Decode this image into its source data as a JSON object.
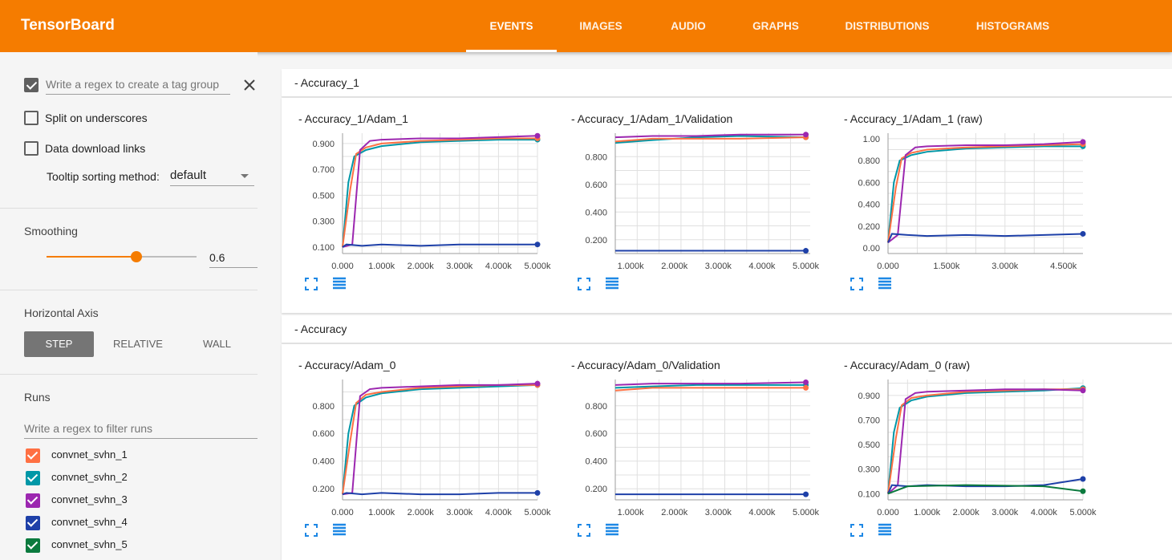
{
  "app": {
    "title": "TensorBoard"
  },
  "tabs": [
    {
      "label": "EVENTS",
      "active": true
    },
    {
      "label": "IMAGES",
      "active": false
    },
    {
      "label": "AUDIO",
      "active": false
    },
    {
      "label": "GRAPHS",
      "active": false
    },
    {
      "label": "DISTRIBUTIONS",
      "active": false
    },
    {
      "label": "HISTOGRAMS",
      "active": false
    }
  ],
  "sidebar": {
    "tag_group": {
      "checked": true,
      "placeholder": "Write a regex to create a tag group",
      "value": ""
    },
    "split_underscores": {
      "label": "Split on underscores",
      "checked": false
    },
    "data_download": {
      "label": "Data download links",
      "checked": false
    },
    "tooltip_sorting": {
      "label": "Tooltip sorting method:",
      "value": "default"
    },
    "smoothing": {
      "title": "Smoothing",
      "value": "0.6",
      "slider_fraction": 0.6
    },
    "horizontal_axis": {
      "title": "Horizontal Axis",
      "options": [
        "STEP",
        "RELATIVE",
        "WALL"
      ],
      "selected": "STEP"
    },
    "runs": {
      "title": "Runs",
      "filter_placeholder": "Write a regex to filter runs",
      "items": [
        {
          "name": "convnet_svhn_1",
          "color": "#ff7043",
          "checked": true
        },
        {
          "name": "convnet_svhn_2",
          "color": "#0097a7",
          "checked": true
        },
        {
          "name": "convnet_svhn_3",
          "color": "#9c27b0",
          "checked": true
        },
        {
          "name": "convnet_svhn_4",
          "color": "#1e40a8",
          "checked": true
        },
        {
          "name": "convnet_svhn_5",
          "color": "#0b7a3e",
          "checked": true
        }
      ]
    }
  },
  "colors": {
    "accent": "#f57c00",
    "run1": "#ff7043",
    "run2": "#0097a7",
    "run3": "#9c27b0",
    "run4": "#1e40a8",
    "run5": "#0b7a3e",
    "icon_blue": "#1e88e5"
  },
  "categories": [
    {
      "title": "- Accuracy_1"
    },
    {
      "title": "- Accuracy"
    }
  ],
  "chart_data": [
    {
      "type": "line",
      "title": "- Accuracy_1/Adam_1",
      "xlim": [
        0,
        5000
      ],
      "ylim": [
        0.05,
        0.98
      ],
      "x_ticks": [
        0,
        1000,
        2000,
        3000,
        4000,
        5000
      ],
      "x_tick_labels": [
        "0.000",
        "1.000k",
        "2.000k",
        "3.000k",
        "4.000k",
        "5.000k"
      ],
      "y_ticks": [
        0.1,
        0.3,
        0.5,
        0.7,
        0.9
      ],
      "y_tick_labels": [
        "0.100",
        "0.300",
        "0.500",
        "0.700",
        "0.900"
      ],
      "series": [
        {
          "color": "#0097a7",
          "x": [
            0,
            150,
            300,
            600,
            1000,
            2000,
            3000,
            4000,
            5000
          ],
          "y": [
            0.1,
            0.6,
            0.8,
            0.85,
            0.88,
            0.91,
            0.92,
            0.93,
            0.93
          ]
        },
        {
          "color": "#ff7043",
          "x": [
            0,
            200,
            350,
            600,
            1000,
            2000,
            3000,
            4000,
            5000
          ],
          "y": [
            0.1,
            0.55,
            0.82,
            0.87,
            0.9,
            0.92,
            0.93,
            0.94,
            0.94
          ]
        },
        {
          "color": "#9c27b0",
          "x": [
            0,
            250,
            450,
            700,
            1000,
            2000,
            3000,
            4000,
            5000
          ],
          "y": [
            0.1,
            0.12,
            0.85,
            0.92,
            0.93,
            0.94,
            0.94,
            0.95,
            0.96
          ]
        },
        {
          "color": "#1e40a8",
          "x": [
            0,
            100,
            500,
            1000,
            2000,
            3000,
            4000,
            5000
          ],
          "y": [
            0.1,
            0.12,
            0.11,
            0.12,
            0.11,
            0.12,
            0.12,
            0.12
          ]
        }
      ]
    },
    {
      "type": "line",
      "title": "- Accuracy_1/Adam_1/Validation",
      "xlim": [
        650,
        5100
      ],
      "ylim": [
        0.1,
        0.97
      ],
      "x_ticks": [
        1000,
        2000,
        3000,
        4000,
        5000
      ],
      "x_tick_labels": [
        "1.000k",
        "2.000k",
        "3.000k",
        "4.000k",
        "5.000k"
      ],
      "y_ticks": [
        0.2,
        0.4,
        0.6,
        0.8
      ],
      "y_tick_labels": [
        "0.200",
        "0.400",
        "0.600",
        "0.800"
      ],
      "series": [
        {
          "color": "#0097a7",
          "x": [
            650,
            1500,
            2500,
            3500,
            5000
          ],
          "y": [
            0.9,
            0.92,
            0.94,
            0.95,
            0.94
          ]
        },
        {
          "color": "#ff7043",
          "x": [
            650,
            1500,
            2500,
            3500,
            5000
          ],
          "y": [
            0.91,
            0.93,
            0.93,
            0.93,
            0.94
          ]
        },
        {
          "color": "#9c27b0",
          "x": [
            650,
            1500,
            2500,
            3500,
            5000
          ],
          "y": [
            0.94,
            0.95,
            0.95,
            0.96,
            0.96
          ]
        },
        {
          "color": "#1e40a8",
          "x": [
            650,
            2000,
            3500,
            5000
          ],
          "y": [
            0.12,
            0.12,
            0.12,
            0.12
          ]
        }
      ]
    },
    {
      "type": "line",
      "title": "- Accuracy_1/Adam_1 (raw)",
      "xlim": [
        0,
        5000
      ],
      "ylim": [
        -0.05,
        1.05
      ],
      "x_ticks": [
        0,
        1500,
        3000,
        4500
      ],
      "x_tick_labels": [
        "0.000",
        "1.500k",
        "3.000k",
        "4.500k"
      ],
      "y_ticks": [
        0,
        0.2,
        0.4,
        0.6,
        0.8,
        1.0
      ],
      "y_tick_labels": [
        "0.00",
        "0.200",
        "0.400",
        "0.600",
        "0.800",
        "1.00"
      ],
      "series": [
        {
          "color": "#0097a7",
          "x": [
            0,
            150,
            300,
            600,
            1000,
            2000,
            3000,
            4000,
            5000
          ],
          "y": [
            0.05,
            0.6,
            0.8,
            0.85,
            0.88,
            0.91,
            0.92,
            0.93,
            0.93
          ]
        },
        {
          "color": "#ff7043",
          "x": [
            0,
            200,
            350,
            600,
            1000,
            2000,
            3000,
            4000,
            5000
          ],
          "y": [
            0.05,
            0.55,
            0.82,
            0.87,
            0.9,
            0.92,
            0.93,
            0.94,
            0.95
          ]
        },
        {
          "color": "#9c27b0",
          "x": [
            0,
            250,
            450,
            700,
            1000,
            2000,
            3000,
            4000,
            5000
          ],
          "y": [
            0.05,
            0.12,
            0.85,
            0.92,
            0.93,
            0.94,
            0.94,
            0.95,
            0.97
          ]
        },
        {
          "color": "#1e40a8",
          "x": [
            0,
            100,
            500,
            1000,
            2000,
            3000,
            4000,
            5000
          ],
          "y": [
            0.05,
            0.13,
            0.12,
            0.11,
            0.12,
            0.11,
            0.12,
            0.13
          ]
        }
      ]
    },
    {
      "type": "line",
      "title": "- Accuracy/Adam_0",
      "xlim": [
        0,
        5000
      ],
      "ylim": [
        0.12,
        0.99
      ],
      "x_ticks": [
        0,
        1000,
        2000,
        3000,
        4000,
        5000
      ],
      "x_tick_labels": [
        "0.000",
        "1.000k",
        "2.000k",
        "3.000k",
        "4.000k",
        "5.000k"
      ],
      "y_ticks": [
        0.2,
        0.4,
        0.6,
        0.8
      ],
      "y_tick_labels": [
        "0.200",
        "0.400",
        "0.600",
        "0.800"
      ],
      "series": [
        {
          "color": "#0097a7",
          "x": [
            0,
            150,
            300,
            600,
            1000,
            2000,
            3000,
            4000,
            5000
          ],
          "y": [
            0.16,
            0.6,
            0.8,
            0.86,
            0.89,
            0.92,
            0.93,
            0.94,
            0.95
          ]
        },
        {
          "color": "#ff7043",
          "x": [
            0,
            200,
            350,
            600,
            1000,
            2000,
            3000,
            4000,
            5000
          ],
          "y": [
            0.16,
            0.55,
            0.82,
            0.88,
            0.9,
            0.93,
            0.94,
            0.95,
            0.95
          ]
        },
        {
          "color": "#9c27b0",
          "x": [
            0,
            250,
            450,
            700,
            1000,
            2000,
            3000,
            4000,
            5000
          ],
          "y": [
            0.16,
            0.17,
            0.87,
            0.92,
            0.93,
            0.94,
            0.95,
            0.95,
            0.96
          ]
        },
        {
          "color": "#1e40a8",
          "x": [
            0,
            100,
            500,
            1000,
            2000,
            3000,
            4000,
            5000
          ],
          "y": [
            0.16,
            0.17,
            0.16,
            0.17,
            0.16,
            0.16,
            0.17,
            0.17
          ]
        }
      ]
    },
    {
      "type": "line",
      "title": "- Accuracy/Adam_0/Validation",
      "xlim": [
        650,
        5100
      ],
      "ylim": [
        0.12,
        0.99
      ],
      "x_ticks": [
        1000,
        2000,
        3000,
        4000,
        5000
      ],
      "x_tick_labels": [
        "1.000k",
        "2.000k",
        "3.000k",
        "4.000k",
        "5.000k"
      ],
      "y_ticks": [
        0.2,
        0.4,
        0.6,
        0.8
      ],
      "y_tick_labels": [
        "0.200",
        "0.400",
        "0.600",
        "0.800"
      ],
      "series": [
        {
          "color": "#0097a7",
          "x": [
            650,
            1500,
            2500,
            3500,
            5000
          ],
          "y": [
            0.93,
            0.94,
            0.95,
            0.95,
            0.95
          ]
        },
        {
          "color": "#ff7043",
          "x": [
            650,
            1500,
            2500,
            3500,
            5000
          ],
          "y": [
            0.91,
            0.93,
            0.93,
            0.93,
            0.93
          ]
        },
        {
          "color": "#9c27b0",
          "x": [
            650,
            1500,
            2500,
            3500,
            5000
          ],
          "y": [
            0.95,
            0.96,
            0.96,
            0.96,
            0.97
          ]
        },
        {
          "color": "#1e40a8",
          "x": [
            650,
            2000,
            3500,
            5000
          ],
          "y": [
            0.16,
            0.16,
            0.16,
            0.16
          ]
        }
      ]
    },
    {
      "type": "line",
      "title": "- Accuracy/Adam_0 (raw)",
      "xlim": [
        0,
        5000
      ],
      "ylim": [
        0.05,
        1.03
      ],
      "x_ticks": [
        0,
        1000,
        2000,
        3000,
        4000,
        5000
      ],
      "x_tick_labels": [
        "0.000",
        "1.000k",
        "2.000k",
        "3.000k",
        "4.000k",
        "5.000k"
      ],
      "y_ticks": [
        0.1,
        0.3,
        0.5,
        0.7,
        0.9
      ],
      "y_tick_labels": [
        "0.100",
        "0.300",
        "0.500",
        "0.700",
        "0.900"
      ],
      "series": [
        {
          "color": "#0097a7",
          "x": [
            0,
            150,
            300,
            600,
            1000,
            2000,
            3000,
            4000,
            5000
          ],
          "y": [
            0.1,
            0.6,
            0.8,
            0.86,
            0.89,
            0.92,
            0.93,
            0.94,
            0.96
          ]
        },
        {
          "color": "#ff7043",
          "x": [
            0,
            200,
            350,
            600,
            1000,
            2000,
            3000,
            4000,
            5000
          ],
          "y": [
            0.1,
            0.55,
            0.82,
            0.88,
            0.9,
            0.93,
            0.94,
            0.95,
            0.95
          ]
        },
        {
          "color": "#9c27b0",
          "x": [
            0,
            250,
            450,
            700,
            1000,
            2000,
            3000,
            4000,
            5000
          ],
          "y": [
            0.1,
            0.17,
            0.87,
            0.92,
            0.93,
            0.94,
            0.95,
            0.95,
            0.94
          ]
        },
        {
          "color": "#1e40a8",
          "x": [
            0,
            100,
            500,
            1000,
            2000,
            3000,
            4000,
            5000
          ],
          "y": [
            0.1,
            0.17,
            0.16,
            0.17,
            0.16,
            0.16,
            0.17,
            0.22
          ]
        },
        {
          "color": "#0b7a3e",
          "x": [
            0,
            500,
            2000,
            4000,
            5000
          ],
          "y": [
            0.1,
            0.16,
            0.17,
            0.16,
            0.12
          ]
        }
      ]
    }
  ]
}
